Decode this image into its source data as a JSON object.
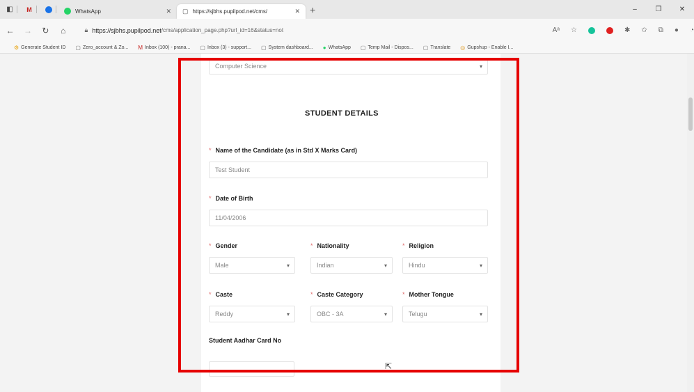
{
  "browser": {
    "tabs": [
      {
        "label": "WhatsApp",
        "active": false
      },
      {
        "label": "https://sjbhs.pupilpod.net/cms/",
        "active": true
      }
    ],
    "new_tab": "+",
    "address": {
      "host": "https://sjbhs.pupilpod.net",
      "path": "/cms/application_page.php?url_id=16&status=not"
    },
    "bookmarks": [
      "Generate Student ID",
      "Zero_account & Zo...",
      "Inbox (100) - prana...",
      "Inbox (3) - support...",
      "System dashboard...",
      "WhatsApp",
      "Temp Mail - Dispos...",
      "Translate",
      "Gupshup - Enable I..."
    ],
    "window_controls": [
      "–",
      "❐",
      "✕"
    ]
  },
  "form": {
    "course_value": "Computer Science",
    "section_title": "STUDENT DETAILS",
    "fields": {
      "name": {
        "label": "Name of the Candidate (as in Std X Marks Card)",
        "value": "Test Student"
      },
      "dob": {
        "label": "Date of Birth",
        "value": "11/04/2006"
      },
      "gender": {
        "label": "Gender",
        "value": "Male"
      },
      "nationality": {
        "label": "Nationality",
        "value": "Indian"
      },
      "religion": {
        "label": "Religion",
        "value": "Hindu"
      },
      "caste": {
        "label": "Caste",
        "value": "Reddy"
      },
      "caste_category": {
        "label": "Caste Category",
        "value": "OBC - 3A"
      },
      "mother_tongue": {
        "label": "Mother Tongue",
        "value": "Telugu"
      },
      "aadhar": {
        "label": "Student Aadhar Card No",
        "value": ""
      }
    },
    "required_mark": "*"
  },
  "colors": {
    "highlight": "#e60000",
    "required": "#e06b6b"
  }
}
